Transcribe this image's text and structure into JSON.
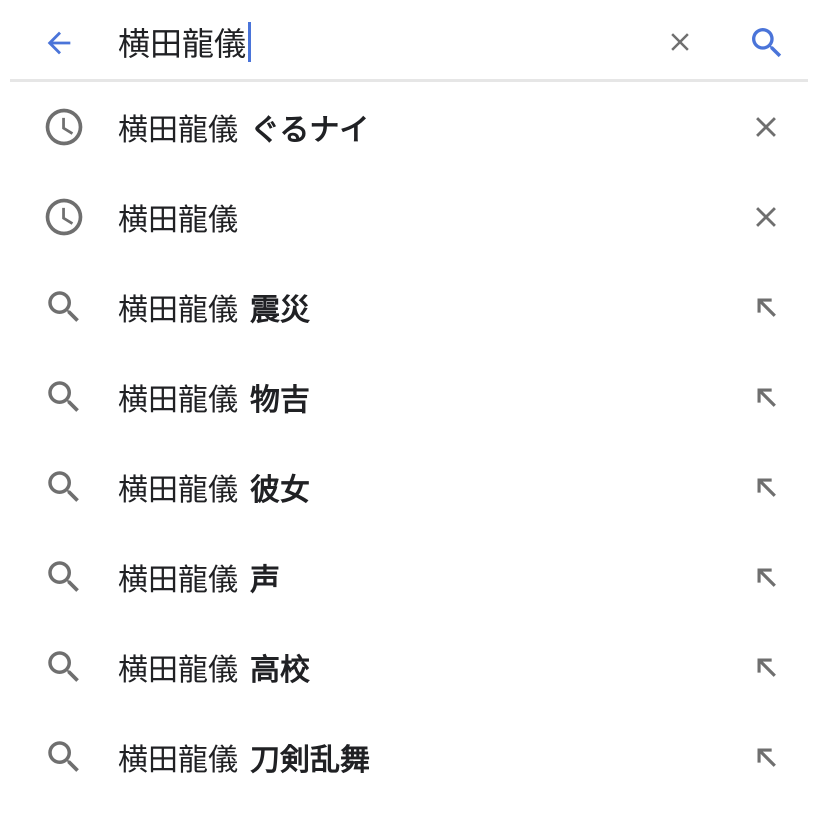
{
  "search": {
    "query": "横田龍儀",
    "accent_color": "#4a74d9",
    "icon_color": "#6f6f6f"
  },
  "header": {
    "back_icon": "arrow-left-icon",
    "clear_icon": "close-icon",
    "search_icon": "search-icon"
  },
  "suggestions": [
    {
      "type": "history",
      "prefix": "横田龍儀",
      "suffix": "ぐるナイ",
      "action_icon": "remove-icon"
    },
    {
      "type": "history",
      "prefix": "横田龍儀",
      "suffix": "",
      "action_icon": "remove-icon"
    },
    {
      "type": "search",
      "prefix": "横田龍儀",
      "suffix": "震災",
      "action_icon": "fill-query-arrow-icon"
    },
    {
      "type": "search",
      "prefix": "横田龍儀",
      "suffix": "物吉",
      "action_icon": "fill-query-arrow-icon"
    },
    {
      "type": "search",
      "prefix": "横田龍儀",
      "suffix": "彼女",
      "action_icon": "fill-query-arrow-icon"
    },
    {
      "type": "search",
      "prefix": "横田龍儀",
      "suffix": "声",
      "action_icon": "fill-query-arrow-icon"
    },
    {
      "type": "search",
      "prefix": "横田龍儀",
      "suffix": "高校",
      "action_icon": "fill-query-arrow-icon"
    },
    {
      "type": "search",
      "prefix": "横田龍儀",
      "suffix": "刀剣乱舞",
      "action_icon": "fill-query-arrow-icon"
    }
  ]
}
